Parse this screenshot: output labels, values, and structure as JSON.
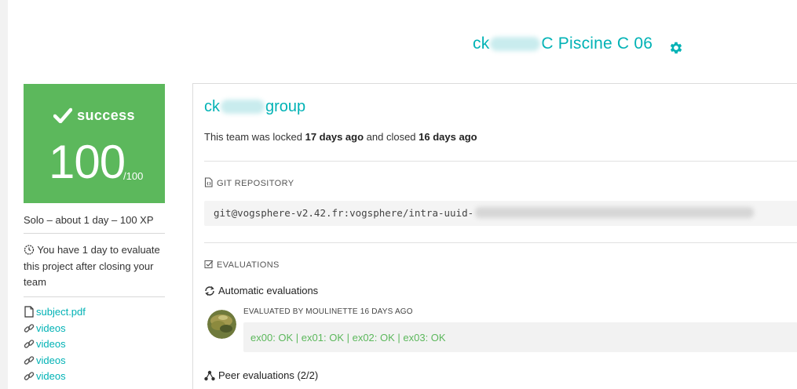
{
  "header": {
    "title_prefix": "ck",
    "title_suffix": "C Piscine C 06"
  },
  "score": {
    "status": "success",
    "value": "100",
    "max": "/100",
    "color": "#5cb85c"
  },
  "project_meta": "Solo – about 1 day – 100 XP",
  "evaluation_window": "You have 1 day to evaluate this project after closing your team",
  "attachments": [
    {
      "label": "subject.pdf",
      "icon": "file-icon"
    },
    {
      "label": "videos",
      "icon": "link-icon"
    },
    {
      "label": "videos",
      "icon": "link-icon"
    },
    {
      "label": "videos",
      "icon": "link-icon"
    },
    {
      "label": "videos",
      "icon": "link-icon"
    }
  ],
  "team": {
    "name_prefix": "ck",
    "name_suffix": "group",
    "lock_text_1": "This team was locked ",
    "locked_ago": "17 days ago",
    "lock_text_2": " and closed ",
    "closed_ago": "16 days ago"
  },
  "git": {
    "section_title": "GIT REPOSITORY",
    "url": "git@vogsphere-v2.42.fr:vogsphere/intra-uuid-"
  },
  "evaluations": {
    "section_title": "EVALUATIONS",
    "automatic_title": "Automatic evaluations",
    "evaluator_line": "EVALUATED BY MOULINETTE 16 DAYS AGO",
    "result": "ex00: OK | ex01: OK | ex02: OK | ex03: OK",
    "peer_title": "Peer evaluations (2/2)"
  },
  "colors": {
    "accent": "#00b2b5",
    "success": "#5cb85c"
  }
}
